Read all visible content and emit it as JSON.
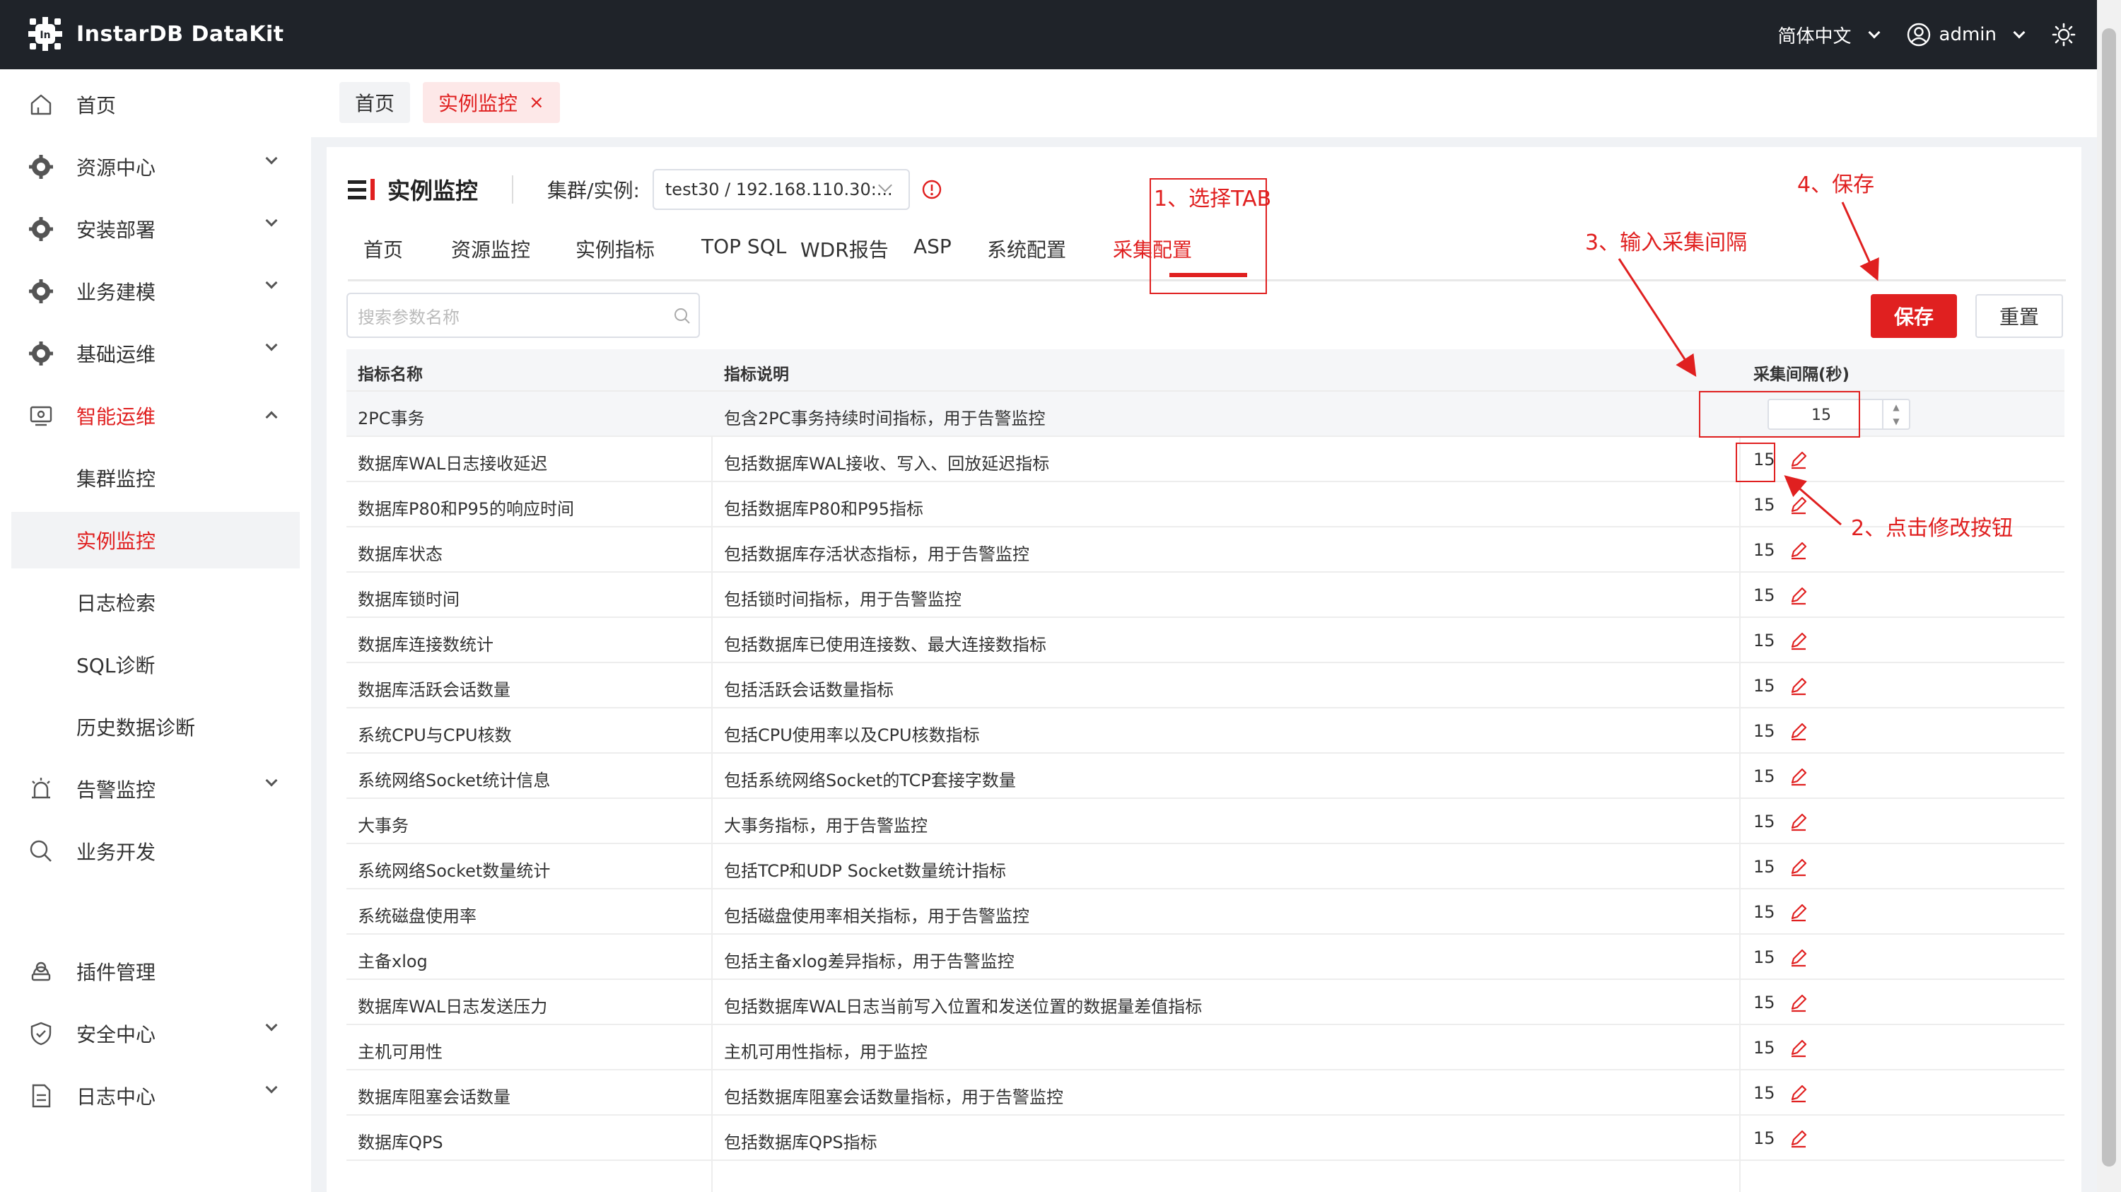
{
  "app": {
    "title": "InstarDB DataKit"
  },
  "topbar": {
    "language": "简体中文",
    "user": "admin"
  },
  "sidebar": {
    "items": [
      {
        "label": "首页",
        "icon": "home-icon"
      },
      {
        "label": "资源中心",
        "icon": "gear-icon"
      },
      {
        "label": "安装部署",
        "icon": "gear-icon"
      },
      {
        "label": "业务建模",
        "icon": "gear-icon"
      },
      {
        "label": "基础运维",
        "icon": "gear-icon"
      },
      {
        "label": "智能运维",
        "icon": "monitor-icon"
      },
      {
        "label": "集群监控"
      },
      {
        "label": "实例监控"
      },
      {
        "label": "日志检索"
      },
      {
        "label": "SQL诊断"
      },
      {
        "label": "历史数据诊断"
      },
      {
        "label": "告警监控",
        "icon": "alarm-icon"
      },
      {
        "label": "业务开发",
        "icon": "search-icon"
      },
      {
        "label": "插件管理",
        "icon": "plugin-icon"
      },
      {
        "label": "安全中心",
        "icon": "shield-icon"
      },
      {
        "label": "日志中心",
        "icon": "document-icon"
      }
    ]
  },
  "page_tabs": {
    "home": "首页",
    "current": "实例监控",
    "close": "×"
  },
  "header": {
    "title": "实例监控",
    "cluster_label": "集群/实例:",
    "cluster_value": "test30 / 192.168.110.30:..."
  },
  "tabs": [
    "首页",
    "资源监控",
    "实例指标",
    "TOP SQL",
    "WDR报告",
    "ASP",
    "系统配置",
    "采集配置"
  ],
  "search": {
    "placeholder": "搜索参数名称"
  },
  "buttons": {
    "save": "保存",
    "reset": "重置"
  },
  "table": {
    "headers": [
      "指标名称",
      "指标说明",
      "采集间隔(秒)"
    ],
    "rows": [
      {
        "name": "2PC事务",
        "desc": "包含2PC事务持续时间指标，用于告警监控",
        "interval": "15"
      },
      {
        "name": "数据库WAL日志接收延迟",
        "desc": "包括数据库WAL接收、写入、回放延迟指标",
        "interval": "15"
      },
      {
        "name": "数据库P80和P95的响应时间",
        "desc": "包括数据库P80和P95指标",
        "interval": "15"
      },
      {
        "name": "数据库状态",
        "desc": "包括数据库存活状态指标，用于告警监控",
        "interval": "15"
      },
      {
        "name": "数据库锁时间",
        "desc": "包括锁时间指标，用于告警监控",
        "interval": "15"
      },
      {
        "name": "数据库连接数统计",
        "desc": "包括数据库已使用连接数、最大连接数指标",
        "interval": "15"
      },
      {
        "name": "数据库活跃会话数量",
        "desc": "包括活跃会话数量指标",
        "interval": "15"
      },
      {
        "name": "系统CPU与CPU核数",
        "desc": "包括CPU使用率以及CPU核数指标",
        "interval": "15"
      },
      {
        "name": "系统网络Socket统计信息",
        "desc": "包括系统网络Socket的TCP套接字数量",
        "interval": "15"
      },
      {
        "name": "大事务",
        "desc": "大事务指标，用于告警监控",
        "interval": "15"
      },
      {
        "name": "系统网络Socket数量统计",
        "desc": "包括TCP和UDP Socket数量统计指标",
        "interval": "15"
      },
      {
        "name": "系统磁盘使用率",
        "desc": "包括磁盘使用率相关指标，用于告警监控",
        "interval": "15"
      },
      {
        "name": "主备xlog",
        "desc": "包括主备xlog差异指标，用于告警监控",
        "interval": "15"
      },
      {
        "name": "数据库WAL日志发送压力",
        "desc": "包括数据库WAL日志当前写入位置和发送位置的数据量差值指标",
        "interval": "15"
      },
      {
        "name": "主机可用性",
        "desc": "主机可用性指标，用于监控",
        "interval": "15"
      },
      {
        "name": "数据库阻塞会话数量",
        "desc": "包括数据库阻塞会话数量指标，用于告警监控",
        "interval": "15"
      },
      {
        "name": "数据库QPS",
        "desc": "包括数据库QPS指标",
        "interval": "15"
      }
    ]
  },
  "annotations": {
    "step1": "1、选择TAB",
    "step2": "2、点击修改按钮",
    "step3": "3、输入采集间隔",
    "step4": "4、保存"
  },
  "colors": {
    "accent": "#e02020",
    "topbar": "#1f2329"
  }
}
